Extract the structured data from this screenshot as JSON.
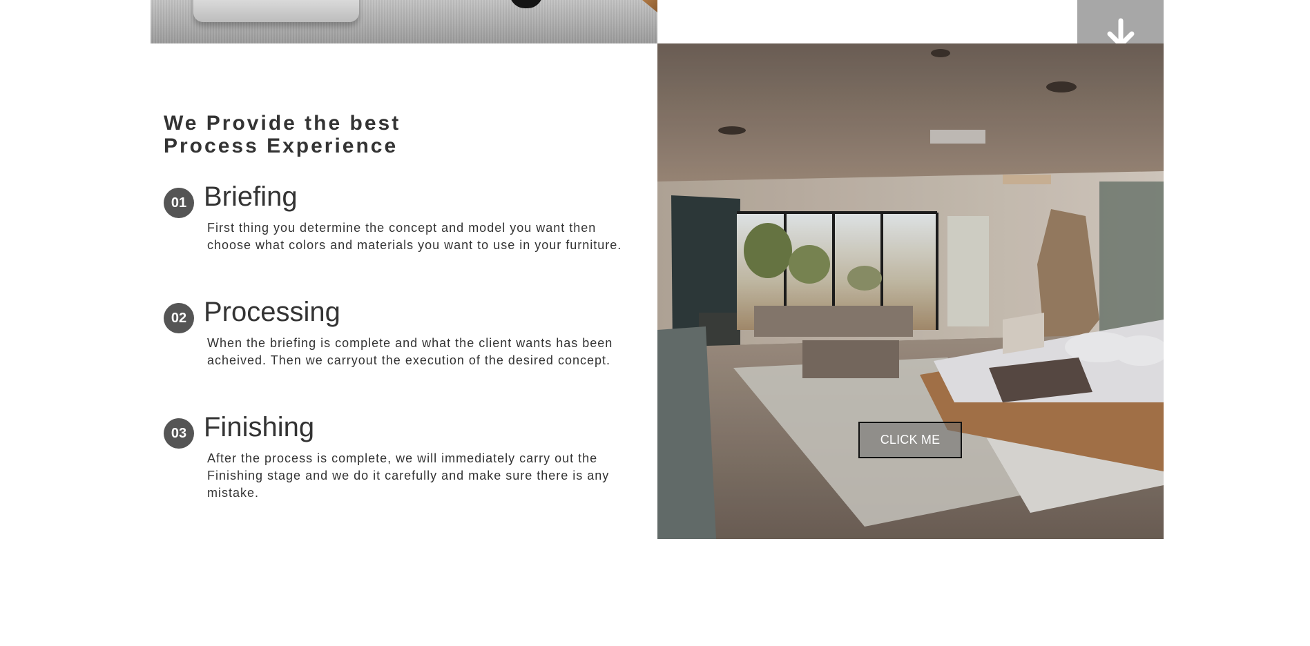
{
  "scroll_button": {
    "icon": "arrow-down-icon",
    "background": "#a7a7a7"
  },
  "section": {
    "title": "We Provide the best\nProcess Experience"
  },
  "steps": [
    {
      "number": "01",
      "title": "Briefing",
      "text": "First thing you determine the concept and model you want then choose what colors and materials you want to use in your furniture."
    },
    {
      "number": "02",
      "title": "Processing",
      "text": "When the briefing is complete and what the client wants has been acheived. Then we carryout the execution of the desired concept."
    },
    {
      "number": "03",
      "title": "Finishing",
      "text": "After the process is complete, we will immediately carry out the Finishing stage and we do it carefully and make sure there is any mistake."
    }
  ],
  "hero": {
    "button_label": "CLICK ME"
  },
  "colors": {
    "text": "#333333",
    "badge": "#555555",
    "button_border": "#111111"
  }
}
